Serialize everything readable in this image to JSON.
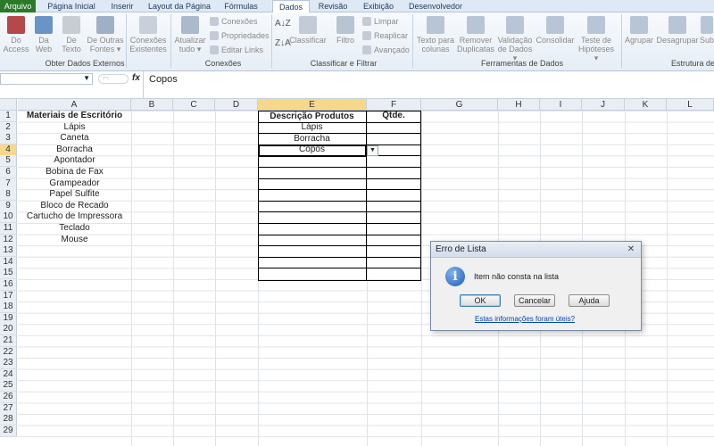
{
  "tabs": [
    "Arquivo",
    "Página Inicial",
    "Inserir",
    "Layout da Página",
    "Fórmulas",
    "Dados",
    "Revisão",
    "Exibição",
    "Desenvolvedor"
  ],
  "ribbon": {
    "groups": {
      "external": "Obter Dados Externos",
      "connections": "Conexões",
      "sort": "Classificar e Filtrar",
      "tools": "Ferramentas de Dados",
      "outline": "Estrutura de"
    },
    "buttons": {
      "from_access": [
        "Do",
        "Access"
      ],
      "from_web": [
        "Da",
        "Web"
      ],
      "from_text": [
        "De",
        "Texto"
      ],
      "other_sources": [
        "De Outras",
        "Fontes ▾"
      ],
      "existing_conn": [
        "Conexões",
        "Existentes"
      ],
      "refresh_all": [
        "Atualizar",
        "tudo ▾"
      ],
      "conn_small": "Conexões",
      "properties_small": "Propriedades",
      "edit_links_small": "Editar Links",
      "sort": "Classificar",
      "filter": "Filtro",
      "clear_small": "Limpar",
      "reapply_small": "Reaplicar",
      "advanced_small": "Avançado",
      "text_to_cols": [
        "Texto para",
        "colunas"
      ],
      "remove_dups": [
        "Remover",
        "Duplicatas"
      ],
      "validation": [
        "Validação",
        "de Dados ▾"
      ],
      "consolidate": "Consolidar",
      "whatif": [
        "Teste de",
        "Hipóteses ▾"
      ],
      "group": "Agrupar",
      "ungroup": "Desagrupar",
      "subtotal": "Sub"
    }
  },
  "formula_bar": {
    "name_box": "",
    "fx": "fx",
    "content": "Copos"
  },
  "columns": [
    "A",
    "B",
    "C",
    "D",
    "E",
    "F",
    "G",
    "H",
    "I",
    "J",
    "K",
    "L"
  ],
  "rows": [
    "1",
    "2",
    "3",
    "4",
    "5",
    "6",
    "7",
    "8",
    "9",
    "10",
    "11",
    "12",
    "13",
    "14",
    "15",
    "16",
    "17",
    "18",
    "19",
    "20",
    "21",
    "22",
    "23",
    "24",
    "25",
    "26",
    "27",
    "28",
    "29"
  ],
  "col_a": [
    "Materiais de Escritório",
    "Lápis",
    "Caneta",
    "Borracha",
    "Apontador",
    "Bobina de Fax",
    "Grampeador",
    "Papel Sulfite",
    "Bloco de Recado",
    "Cartucho de Impressora",
    "Teclado",
    "Mouse"
  ],
  "col_e": [
    "Descrição Produtos",
    "Lápis",
    "Borracha",
    "Copos"
  ],
  "col_f_header": "Qtde.",
  "dialog": {
    "title": "Erro de Lista",
    "icon": "info-icon",
    "message": "Item não consta na lista",
    "ok": "OK",
    "cancel": "Cancelar",
    "help": "Ajuda",
    "link": "Estas informações foram úteis?"
  }
}
